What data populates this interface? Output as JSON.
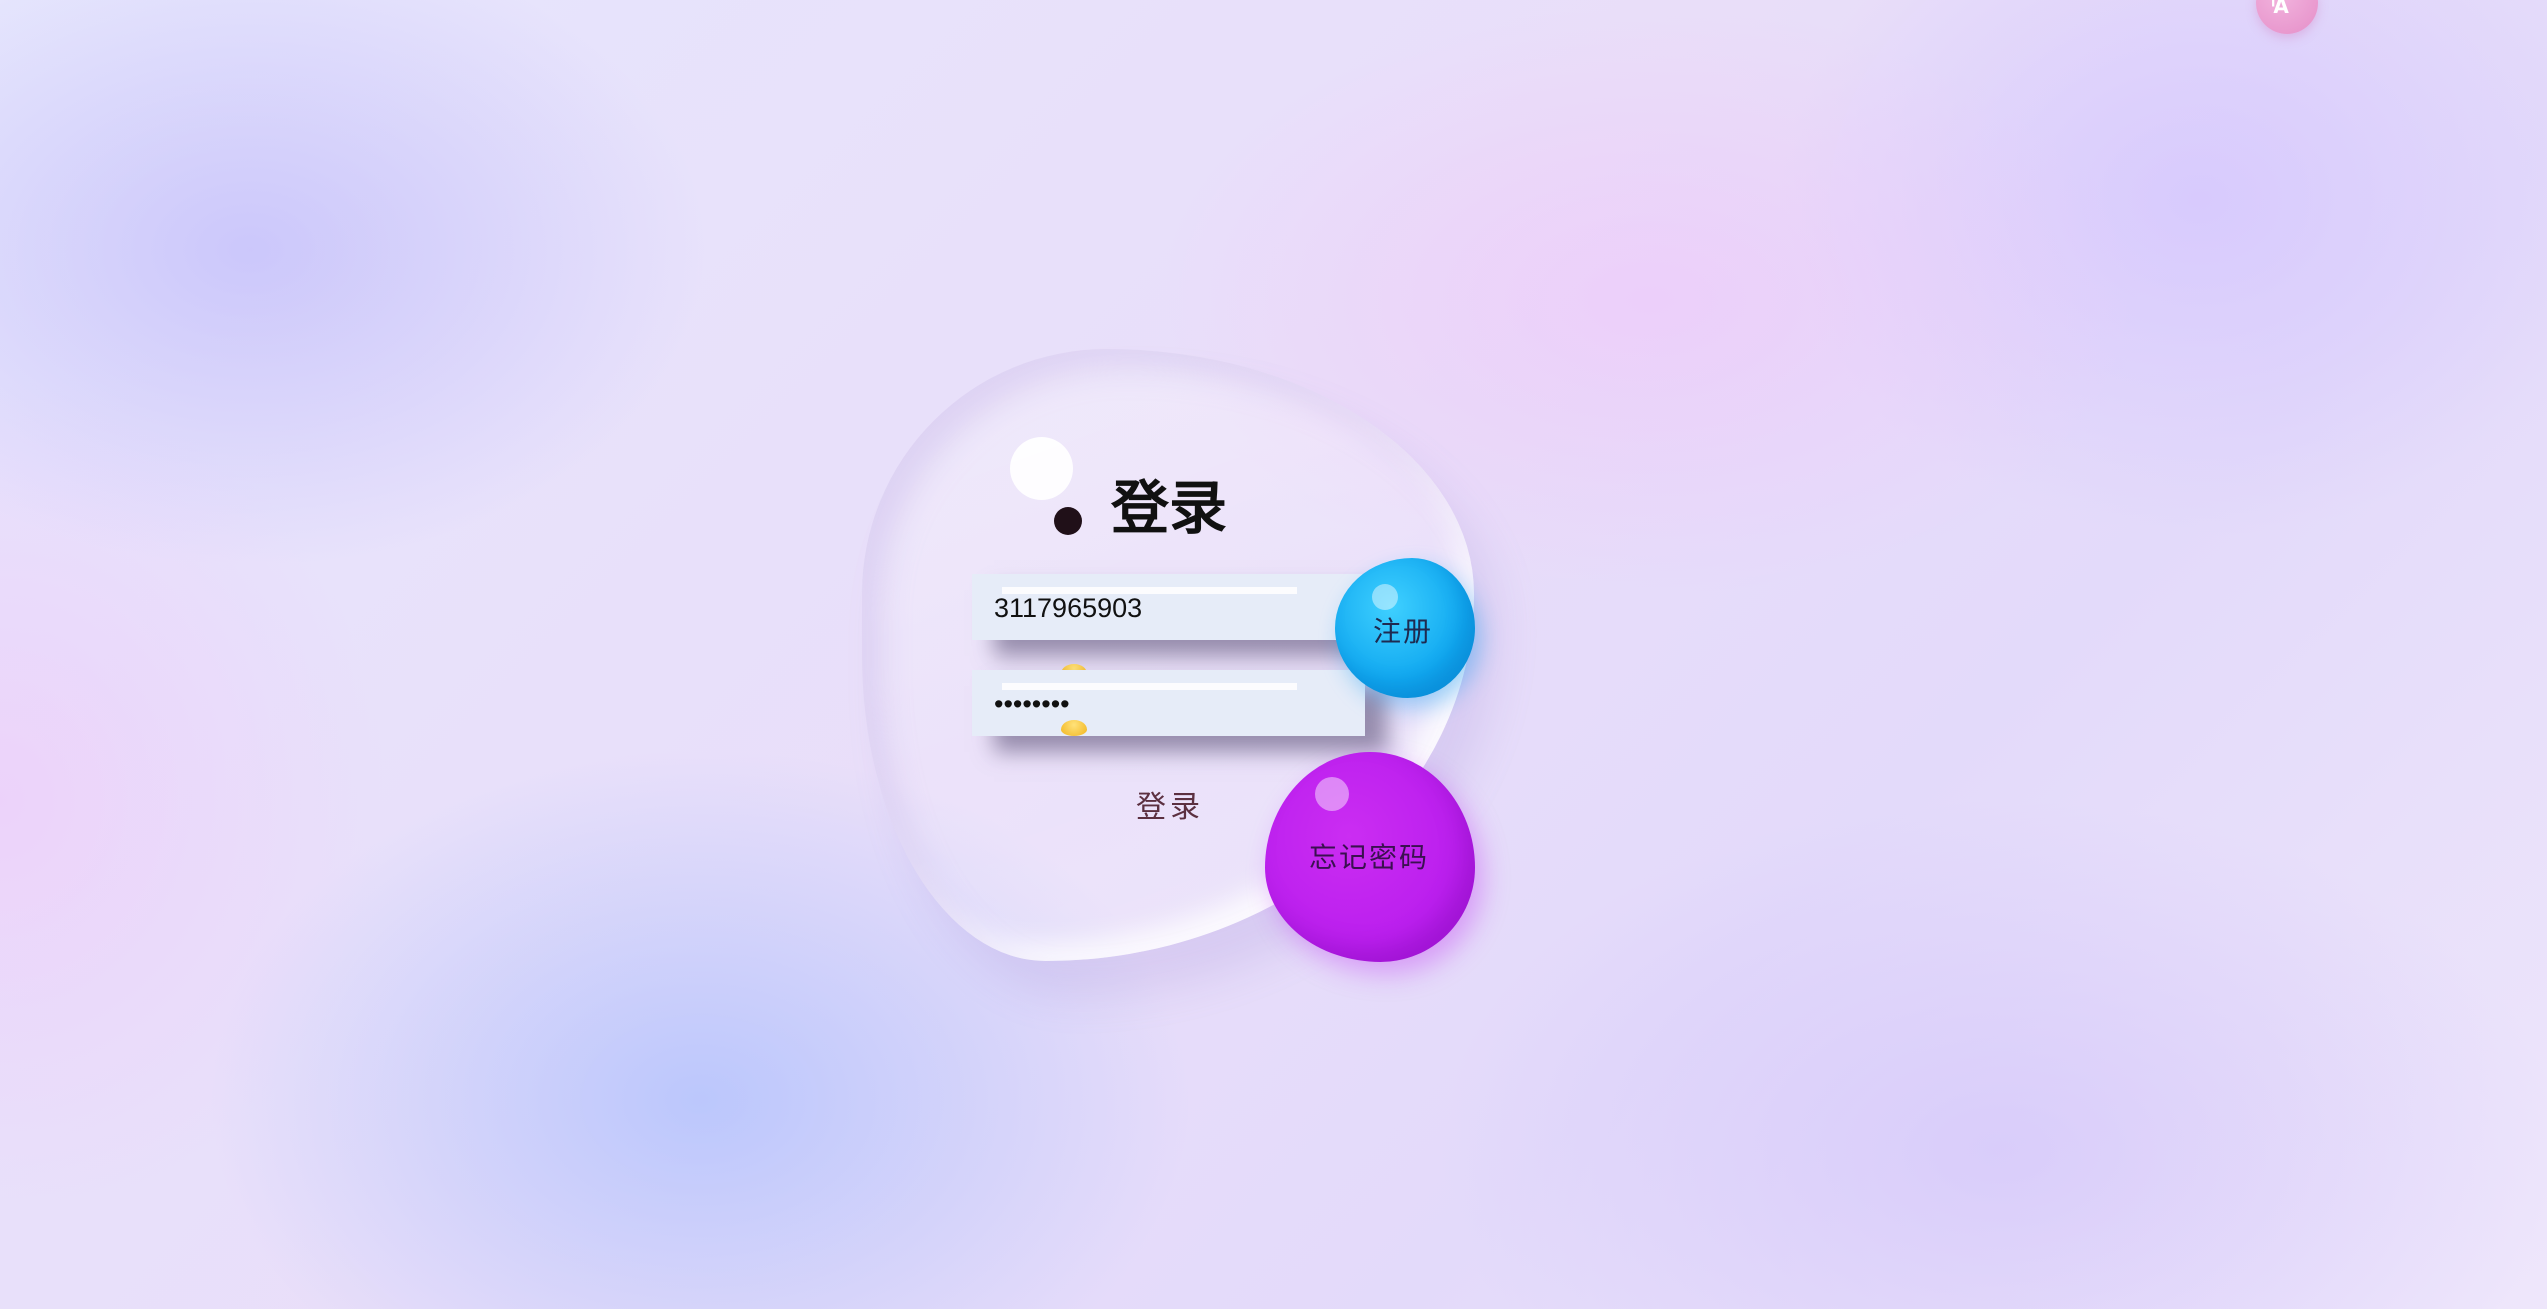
{
  "translate_button": {
    "glyph": "ⁱA",
    "icon": "translate-icon"
  },
  "login_form": {
    "title": "登录",
    "username": {
      "value": "3117965903"
    },
    "password": {
      "value": "••••••••"
    },
    "submit_label": "登录",
    "register_label": "注册",
    "forgot_label": "忘记密码"
  },
  "colors": {
    "register_bubble": "#10a8f0",
    "forgot_bubble": "#bb1fee",
    "translate_bubble": "#e58ec8",
    "input_background": "#e6ecf8"
  }
}
